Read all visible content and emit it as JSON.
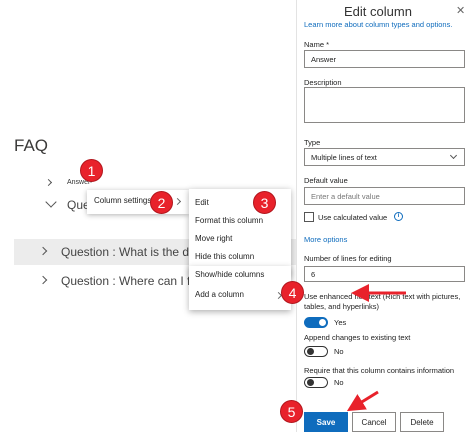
{
  "list": {
    "title": "FAQ",
    "column_header": "Answer",
    "questions": [
      {
        "text": "Que"
      },
      {
        "text": "Question : What is the dea"
      },
      {
        "text": "Question : Where can I find"
      }
    ]
  },
  "column_settings_menu": {
    "label": "Column settings"
  },
  "context_menu": {
    "items": [
      "Edit",
      "Format this column",
      "Move right",
      "Hide this column",
      "Show/hide columns",
      "Add a column"
    ]
  },
  "badges": [
    "1",
    "2",
    "3",
    "4",
    "5"
  ],
  "panel": {
    "title": "Edit column",
    "close_glyph": "✕",
    "learn_more": "Learn more about column types and options.",
    "name_label": "Name *",
    "name_value": "Answer",
    "description_label": "Description",
    "type_label": "Type",
    "type_value": "Multiple lines of text",
    "default_label": "Default value",
    "default_placeholder": "Enter a default value",
    "calc_label": "Use calculated value",
    "info_glyph": "i",
    "more_options": "More options",
    "lines_label": "Number of lines for editing",
    "lines_value": "6",
    "rich_text_label": "Use enhanced rich text (Rich text with pictures, tables, and hyperlinks)",
    "rich_text_state": "Yes",
    "append_label": "Append changes to existing text",
    "append_state": "No",
    "require_label": "Require that this column contains information",
    "require_state": "No",
    "save_label": "Save",
    "cancel_label": "Cancel",
    "delete_label": "Delete"
  },
  "colors": {
    "accent": "#0f6cbd",
    "badge": "#e8222b",
    "arrow": "#e8222b"
  }
}
